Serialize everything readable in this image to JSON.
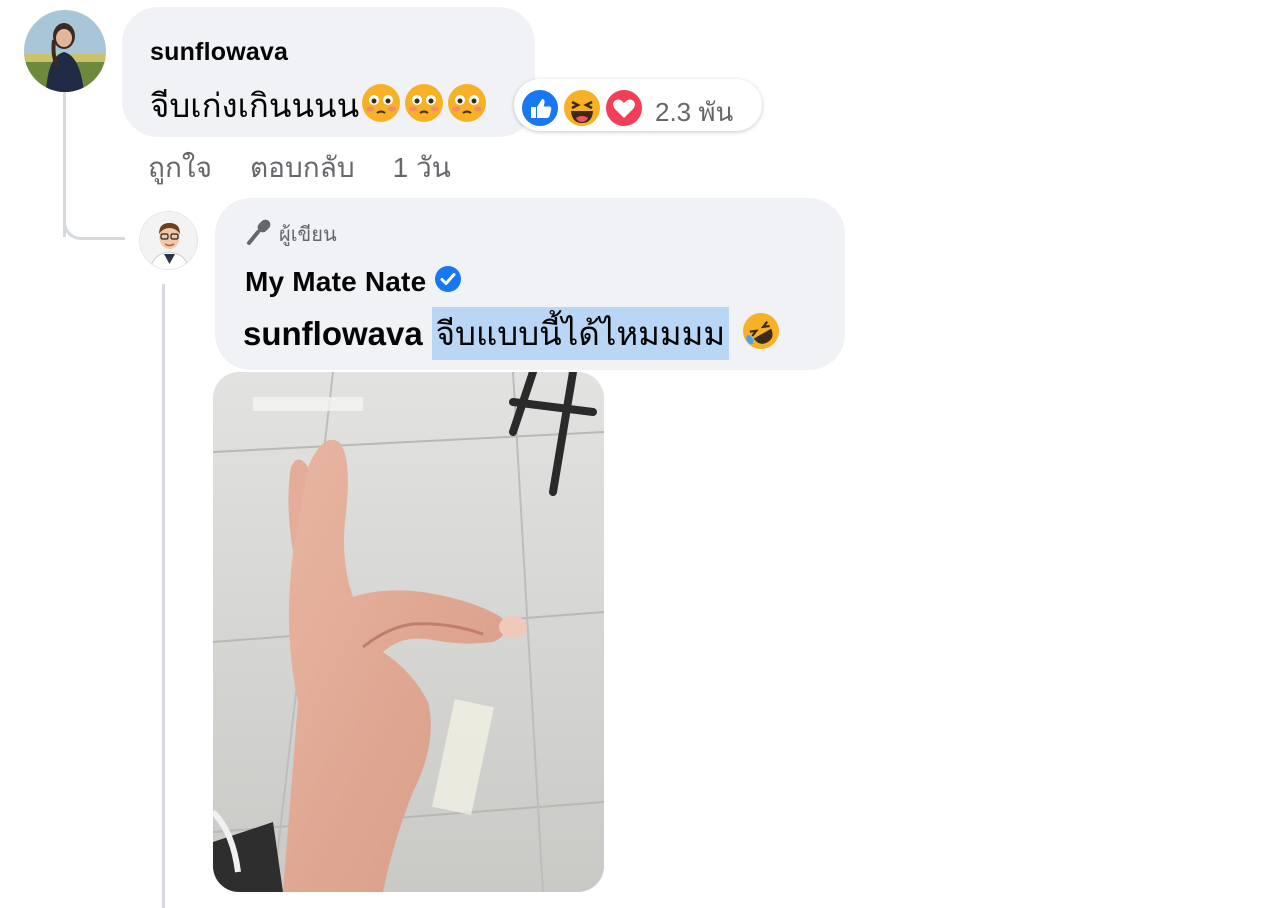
{
  "comment": {
    "author": "sunflowava",
    "text": "จีบเก่งเกินนนน",
    "reaction_count": "2.3 พัน",
    "reaction_icons": [
      "like-icon",
      "haha-icon",
      "love-icon"
    ],
    "text_emoji_icons": [
      "flushed-face-icon",
      "flushed-face-icon",
      "flushed-face-icon"
    ],
    "actions": {
      "like": "ถูกใจ",
      "reply": "ตอบกลับ",
      "time": "1 วัน"
    }
  },
  "reply": {
    "badge": "ผู้เขียน",
    "badge_icon": "microphone-icon",
    "author": "My Mate Nate",
    "verified_icon": "verified-badge-icon",
    "mention": "sunflowava",
    "text": "จีบแบบนี้ได้ไหมมมม",
    "emoji_icon": "rolling-laughing-icon",
    "photo_icon": "hand-gesture-photo"
  },
  "colors": {
    "like": "#1877f2",
    "love": "#f33e58",
    "haha": "#f7b125",
    "selection": "#b9d6f5",
    "bubble": "#f0f2f5"
  }
}
